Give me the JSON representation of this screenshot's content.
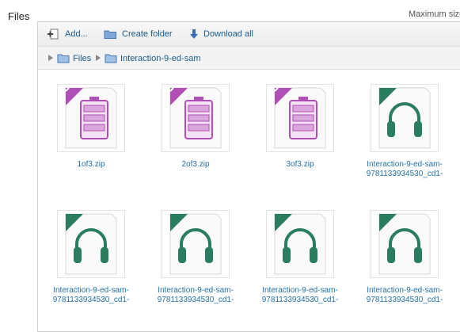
{
  "title": "Files",
  "max_size_label": "Maximum size",
  "toolbar": {
    "add": "Add...",
    "create_folder": "Create folder",
    "download_all": "Download all"
  },
  "path": {
    "root": "Files",
    "folder": "Interaction-9-ed-sam"
  },
  "files": [
    {
      "line1": "1of3.zip",
      "line2": "",
      "type": "zip"
    },
    {
      "line1": "2of3.zip",
      "line2": "",
      "type": "zip"
    },
    {
      "line1": "3of3.zip",
      "line2": "",
      "type": "zip"
    },
    {
      "line1": "Interaction-9-ed-sam-",
      "line2": "9781133934530_cd1-",
      "type": "audio"
    },
    {
      "line1": "Interaction-9-ed-sam-",
      "line2": "9781133934530_cd1-",
      "type": "audio"
    },
    {
      "line1": "Interaction-9-ed-sam-",
      "line2": "9781133934530_cd1-",
      "type": "audio"
    },
    {
      "line1": "Interaction-9-ed-sam-",
      "line2": "9781133934530_cd1-",
      "type": "audio"
    },
    {
      "line1": "Interaction-9-ed-sam-",
      "line2": "9781133934530_cd1-",
      "type": "audio"
    }
  ],
  "colors": {
    "zip": "#b04fb5",
    "audio": "#2a7d5e",
    "link": "#1f6fa8"
  }
}
